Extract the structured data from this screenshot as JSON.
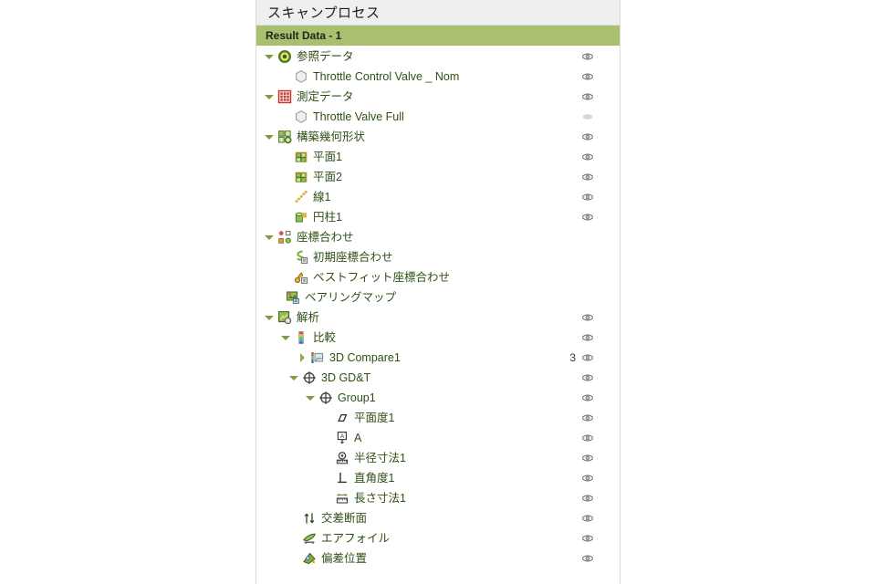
{
  "panel": {
    "header_title": "スキャンプロセス",
    "result_bar_label": "Result Data - 1"
  },
  "tree": {
    "count_3d_compare": "3",
    "items": [
      {
        "label": "参照データ",
        "icon": "reference-data-icon",
        "depth": 0,
        "expander": "down",
        "eye": "visible"
      },
      {
        "label": "Throttle Control Valve _ Nom",
        "icon": "mesh-part-icon",
        "depth": 1,
        "expander": "none",
        "eye": "visible"
      },
      {
        "label": "測定データ",
        "icon": "measured-data-icon",
        "depth": 0,
        "expander": "down",
        "eye": "visible"
      },
      {
        "label": "Throttle Valve Full",
        "icon": "mesh-part-icon",
        "depth": 1,
        "expander": "none",
        "eye": "hidden"
      },
      {
        "label": "構築幾何形状",
        "icon": "constructed-geometry-icon",
        "depth": 0,
        "expander": "down",
        "eye": "visible"
      },
      {
        "label": "平面1",
        "icon": "plane-icon",
        "depth": 1,
        "expander": "none",
        "eye": "visible"
      },
      {
        "label": "平面2",
        "icon": "plane-icon",
        "depth": 1,
        "expander": "none",
        "eye": "visible"
      },
      {
        "label": "線1",
        "icon": "line-icon",
        "depth": 1,
        "expander": "none",
        "eye": "visible"
      },
      {
        "label": "円柱1",
        "icon": "cylinder-icon",
        "depth": 1,
        "expander": "none",
        "eye": "visible"
      },
      {
        "label": "座標合わせ",
        "icon": "alignment-icon",
        "depth": 0,
        "expander": "down",
        "eye": "none"
      },
      {
        "label": "初期座標合わせ",
        "icon": "initial-alignment-icon",
        "depth": 1,
        "expander": "none",
        "eye": "none"
      },
      {
        "label": "ベストフィット座標合わせ",
        "icon": "bestfit-alignment-icon",
        "depth": 1,
        "expander": "none",
        "eye": "none"
      },
      {
        "label": "ベアリングマップ",
        "icon": "bearing-map-icon",
        "depth": 0.5,
        "expander": "none",
        "eye": "none"
      },
      {
        "label": "解析",
        "icon": "analysis-icon",
        "depth": 0,
        "expander": "down",
        "eye": "visible"
      },
      {
        "label": "比較",
        "icon": "compare-colorbar-icon",
        "depth": 1,
        "expander": "down",
        "eye": "visible"
      },
      {
        "label": "3D Compare1",
        "icon": "compare-result-icon",
        "depth": 2,
        "expander": "right",
        "eye": "visible",
        "count": "3"
      },
      {
        "label": "3D GD&T",
        "icon": "gdt-icon",
        "depth": 1.5,
        "expander": "down",
        "eye": "visible"
      },
      {
        "label": "Group1",
        "icon": "gdt-icon",
        "depth": 2.5,
        "expander": "down",
        "eye": "visible"
      },
      {
        "label": "平面度1",
        "icon": "flatness-icon",
        "depth": 3.5,
        "expander": "none",
        "eye": "visible"
      },
      {
        "label": "A",
        "icon": "datum-icon",
        "depth": 3.5,
        "expander": "none",
        "eye": "visible"
      },
      {
        "label": "半径寸法1",
        "icon": "radius-dimension-icon",
        "depth": 3.5,
        "expander": "none",
        "eye": "visible"
      },
      {
        "label": "直角度1",
        "icon": "perpendicularity-icon",
        "depth": 3.5,
        "expander": "none",
        "eye": "visible"
      },
      {
        "label": "長さ寸法1",
        "icon": "length-dimension-icon",
        "depth": 3.5,
        "expander": "none",
        "eye": "visible"
      },
      {
        "label": "交差断面",
        "icon": "cross-section-icon",
        "depth": 1.5,
        "expander": "none",
        "eye": "visible"
      },
      {
        "label": "エアフォイル",
        "icon": "airfoil-icon",
        "depth": 1.5,
        "expander": "none",
        "eye": "visible"
      },
      {
        "label": "偏差位置",
        "icon": "deviation-location-icon",
        "depth": 1.5,
        "expander": "none",
        "eye": "visible"
      }
    ]
  },
  "colors": {
    "result_bar_green": "#a8c070",
    "label_green": "#2f4f16",
    "header_grey": "#efefef",
    "measured_red": "#c0392b"
  }
}
